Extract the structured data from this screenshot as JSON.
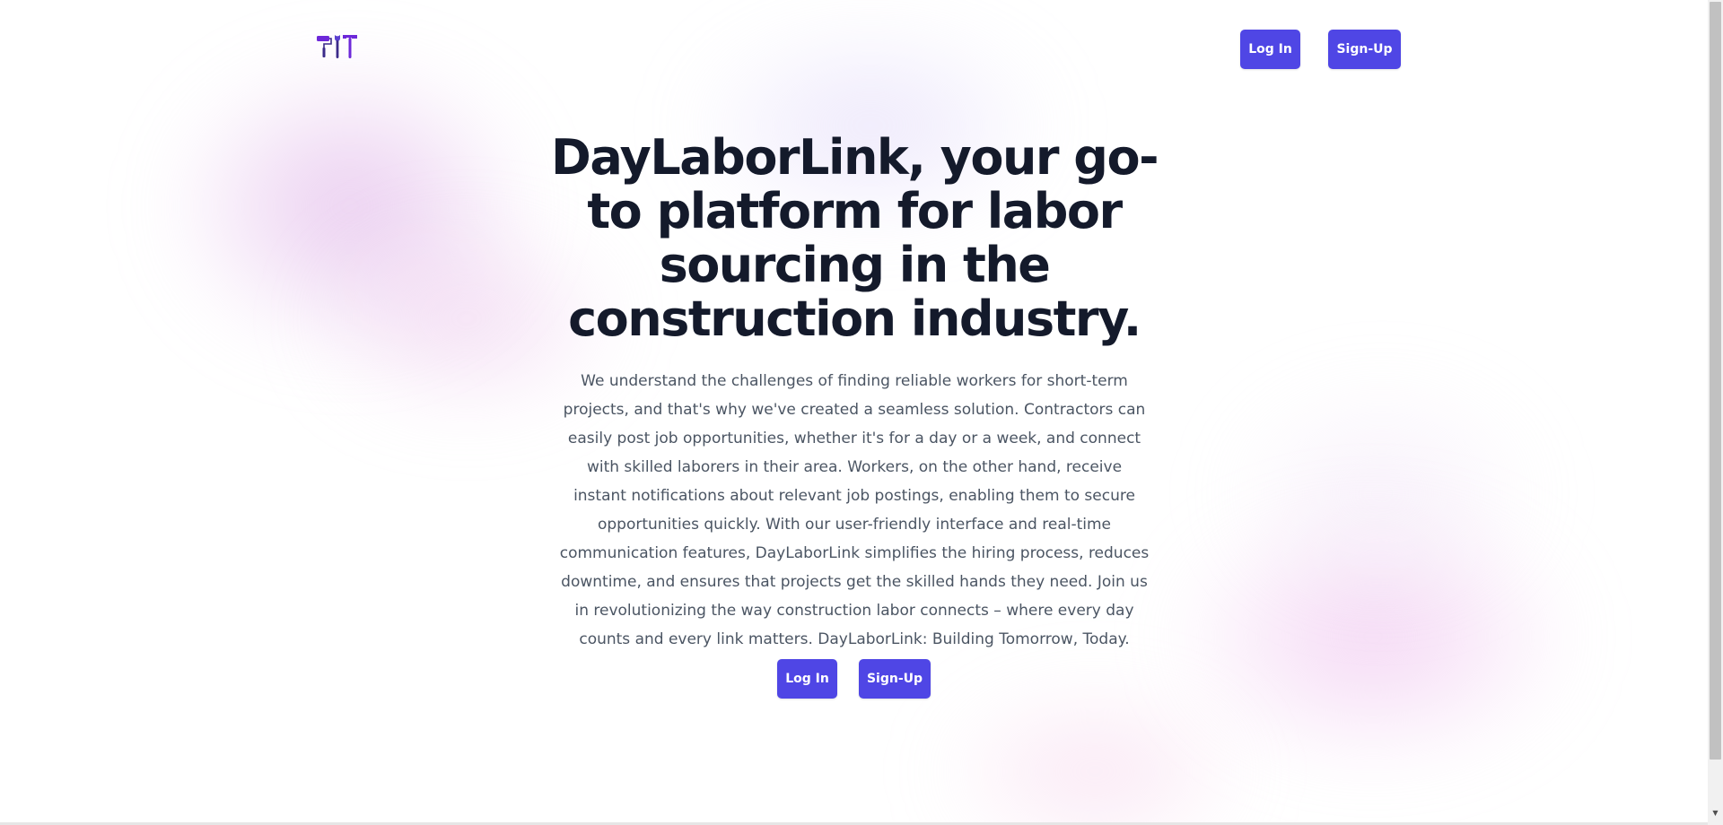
{
  "header": {
    "logo_icon": "tools-icon",
    "login_label": "Log In",
    "signup_label": "Sign-Up"
  },
  "hero": {
    "title": "DayLaborLink, your go-to platform for labor sourcing in the construction industry.",
    "description": "We understand the challenges of finding reliable workers for short-term projects, and that's why we've created a seamless solution. Contractors can easily post job opportunities, whether it's for a day or a week, and connect with skilled laborers in their area. Workers, on the other hand, receive instant notifications about relevant job postings, enabling them to secure opportunities quickly. With our user-friendly interface and real-time communication features, DayLaborLink simplifies the hiring process, reduces downtime, and ensures that projects get the skilled hands they need. Join us in revolutionizing the way construction labor connects – where every day counts and every link matters. DayLaborLink: Building Tomorrow, Today.",
    "login_label": "Log In",
    "signup_label": "Sign-Up"
  },
  "colors": {
    "accent": "#4f46e5",
    "heading": "#141a2b",
    "body_text": "#4b5563",
    "logo_purple": "#6d28d9"
  }
}
